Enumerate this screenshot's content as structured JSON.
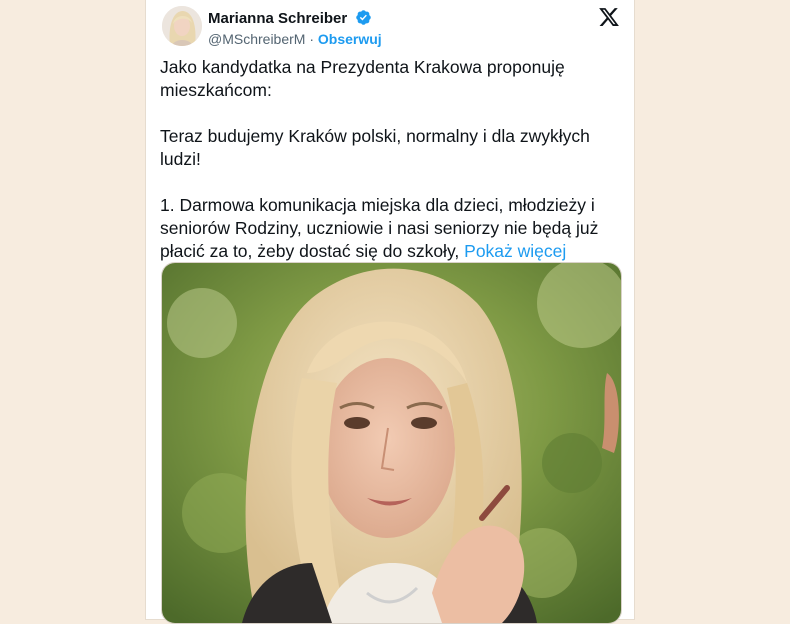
{
  "tweet": {
    "author_name": "Marianna Schreiber",
    "handle": "@MSchreiberM",
    "separator": "·",
    "follow_label": "Obserwuj",
    "paragraphs": [
      "Jako kandydatka na Prezydenta Krakowa proponuję mieszkańcom:",
      "Teraz budujemy Kraków polski, normalny i dla zwykłych ludzi!",
      "1.  Darmowa komunikacja miejska dla dzieci, młodzieży i seniorów Rodziny, uczniowie i nasi seniorzy nie będą już płacić za to, żeby dostać się do szkoły,"
    ],
    "show_more_label": "Pokaż więcej",
    "icons": {
      "platform": "x-logo-icon",
      "verified": "verified-badge-icon"
    }
  },
  "colors": {
    "background": "#f7ecdf",
    "link": "#1d9bf0",
    "text": "#0f1419",
    "secondary_text": "#536471"
  }
}
